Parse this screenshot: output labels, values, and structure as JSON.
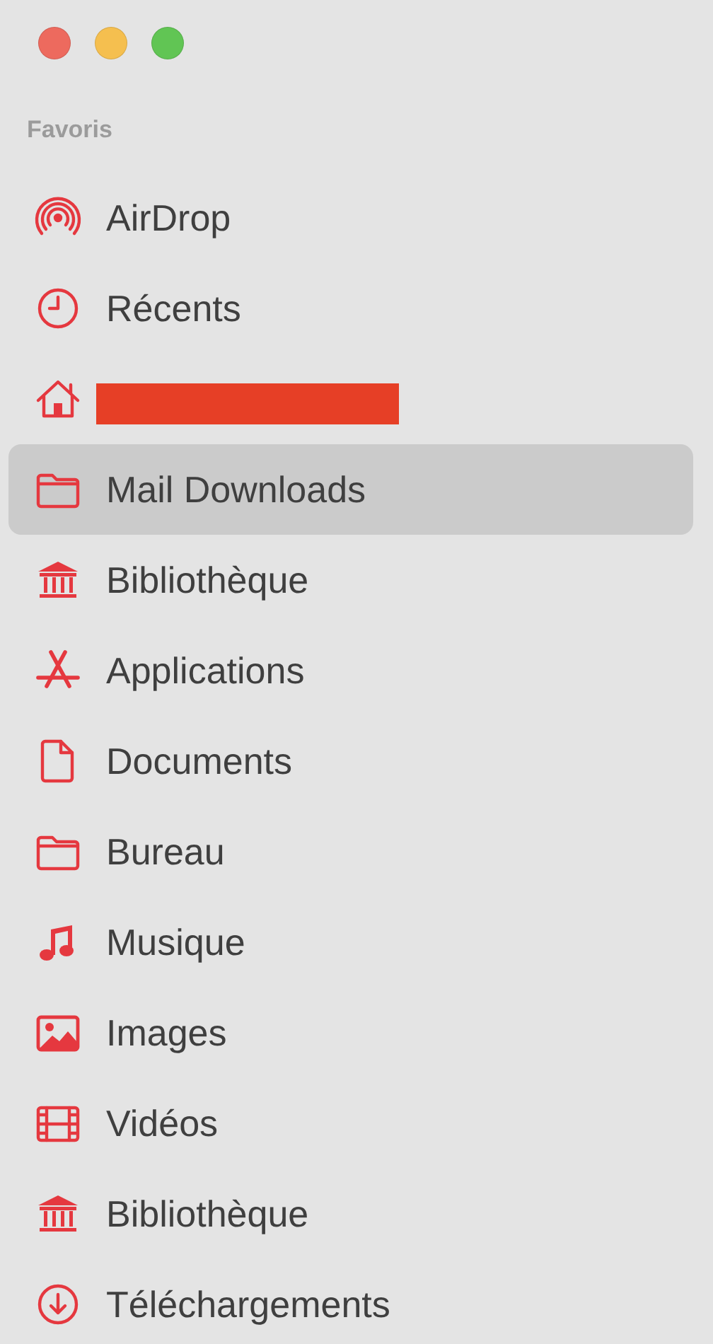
{
  "window": {
    "controls": [
      {
        "color": "#ed6a5e"
      },
      {
        "color": "#f5bf4f"
      },
      {
        "color": "#61c554"
      }
    ]
  },
  "sidebar": {
    "section": "Favoris",
    "items": [
      {
        "kind": "airdrop",
        "label": "AirDrop",
        "selected": false
      },
      {
        "kind": "clock",
        "label": "Récents",
        "selected": false
      },
      {
        "kind": "home",
        "redacted": true,
        "selected": false
      },
      {
        "kind": "folder",
        "label": "Mail Downloads",
        "selected": true
      },
      {
        "kind": "library",
        "label": "Bibliothèque",
        "selected": false
      },
      {
        "kind": "apps",
        "label": "Applications",
        "selected": false
      },
      {
        "kind": "document",
        "label": "Documents",
        "selected": false
      },
      {
        "kind": "folder",
        "label": "Bureau",
        "selected": false
      },
      {
        "kind": "music",
        "label": "Musique",
        "selected": false
      },
      {
        "kind": "image",
        "label": "Images",
        "selected": false
      },
      {
        "kind": "film",
        "label": "Vidéos",
        "selected": false
      },
      {
        "kind": "library",
        "label": "Bibliothèque",
        "selected": false
      },
      {
        "kind": "download",
        "label": "Téléchargements",
        "selected": false
      }
    ]
  }
}
